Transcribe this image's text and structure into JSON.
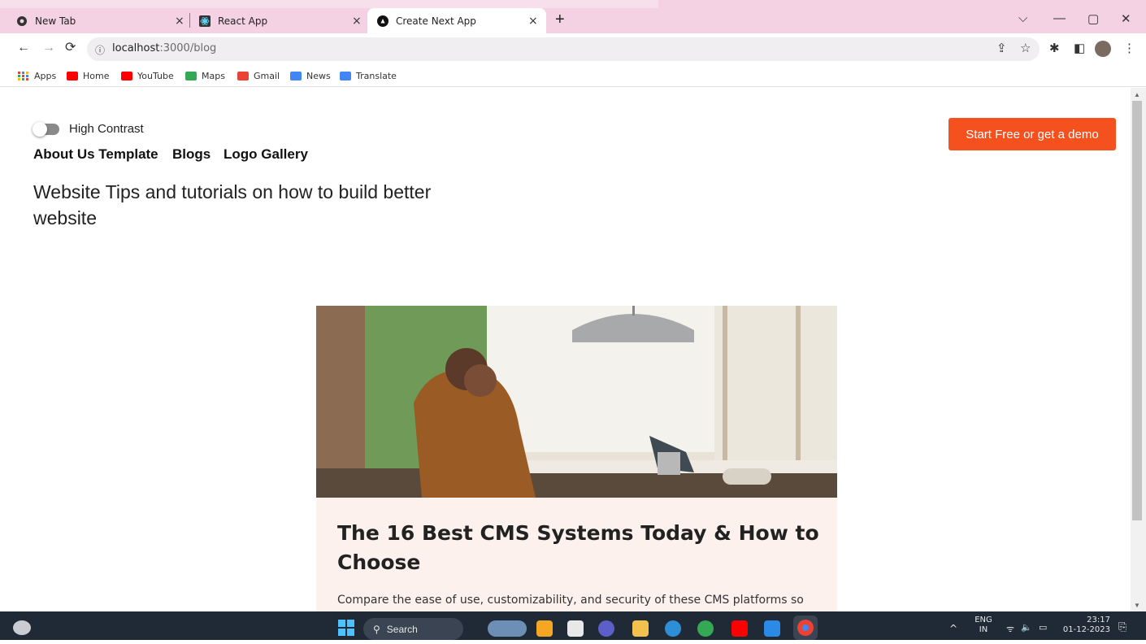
{
  "browser": {
    "tabs": [
      {
        "label": "New Tab",
        "active": false
      },
      {
        "label": "React App",
        "active": false
      },
      {
        "label": "Create Next App",
        "active": true
      }
    ],
    "close_glyph": "×",
    "newtab_glyph": "+",
    "url_host": "localhost",
    "url_path": ":3000/blog",
    "bookmarks": [
      {
        "label": "Apps",
        "icon": "apps-grid-icon",
        "color": "#e8453c"
      },
      {
        "label": "Home",
        "icon": "youtube-icon",
        "color": "#ff0000"
      },
      {
        "label": "YouTube",
        "icon": "youtube-icon",
        "color": "#ff0000"
      },
      {
        "label": "Maps",
        "icon": "maps-icon",
        "color": "#34a853"
      },
      {
        "label": "Gmail",
        "icon": "gmail-icon",
        "color": "#ea4335"
      },
      {
        "label": "News",
        "icon": "news-icon",
        "color": "#4285f4"
      },
      {
        "label": "Translate",
        "icon": "translate-icon",
        "color": "#4285f4"
      }
    ]
  },
  "page": {
    "toggle_label": "High Contrast",
    "toggle_on": false,
    "nav": [
      "About Us Template",
      "Blogs",
      "Logo Gallery"
    ],
    "tagline": "Website Tips and tutorials on how to build better website",
    "cta_label": "Start Free or get a demo",
    "card": {
      "title": "The 16 Best CMS Systems Today & How to Choose",
      "description": "Compare the ease of use, customizability, and security of these CMS platforms so"
    }
  },
  "taskbar": {
    "search_label": "Search",
    "lang_primary": "ENG",
    "lang_secondary": "IN",
    "time": "23:17",
    "date": "01-12-2023"
  },
  "colors": {
    "accent": "#f4511e",
    "tabstrip": "#f4d2e3",
    "card_bg": "#fcf1ed",
    "taskbar": "#202a36"
  }
}
